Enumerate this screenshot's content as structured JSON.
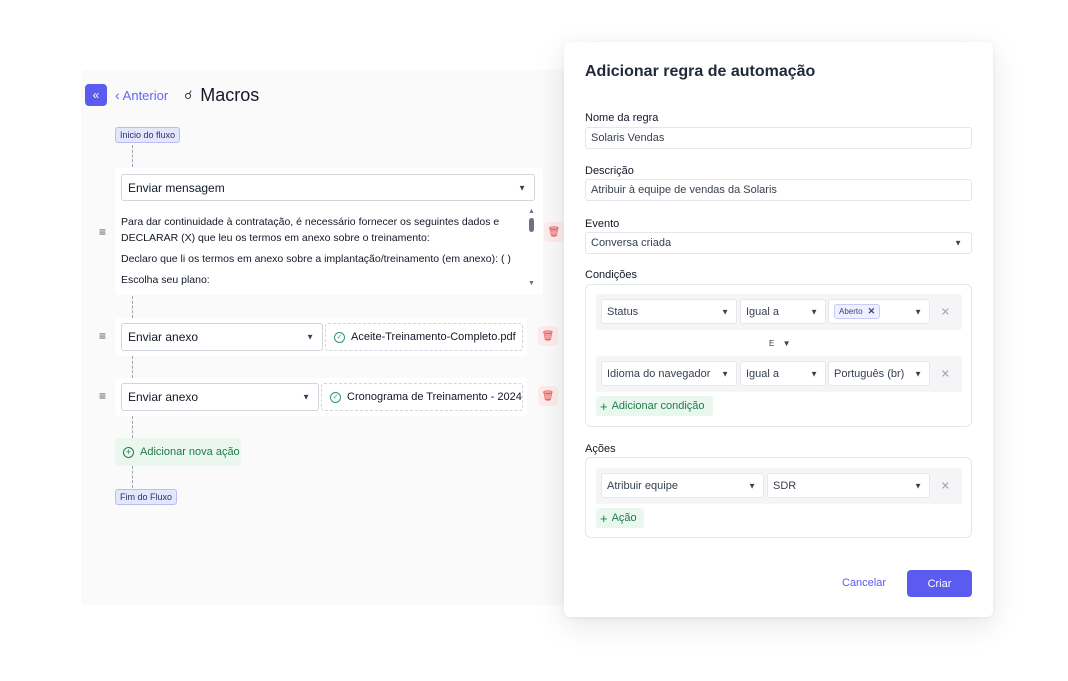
{
  "macros": {
    "back_label": "Anterior",
    "title": "Macros",
    "flow_start": "Inicio do fluxo",
    "flow_end": "Fim do Fluxo",
    "add_action_label": "Adicionar nova ação",
    "steps": [
      {
        "type": "Enviar mensagem",
        "message_lines": [
          "Para dar continuidade à contratação, é necessário fornecer os seguintes dados e",
          "DECLARAR (X) que leu os termos em anexo sobre o treinamento:",
          "Declaro que li os termos em anexo sobre a implantação/treinamento (em anexo): ( )",
          "Escolha seu plano:"
        ]
      },
      {
        "type": "Enviar anexo",
        "file": "Aceite-Treinamento-Completo.pdf"
      },
      {
        "type": "Enviar anexo",
        "file": "Cronograma de Treinamento - 2024..."
      }
    ]
  },
  "modal": {
    "title": "Adicionar regra de automação",
    "rule_name_label": "Nome da regra",
    "rule_name_value": "Solaris Vendas",
    "description_label": "Descrição",
    "description_value": "Atribuir à equipe de vendas da Solaris",
    "event_label": "Evento",
    "event_value": "Conversa criada",
    "conditions_label": "Condições",
    "conditions": [
      {
        "field": "Status",
        "operator": "Igual a",
        "value_chip": "Aberto"
      },
      {
        "field": "Idioma do navegador",
        "operator": "Igual a",
        "value": "Português (br)"
      }
    ],
    "conjunction": "E",
    "add_condition_label": "Adicionar condição",
    "actions_label": "Ações",
    "actions": [
      {
        "action": "Atribuir equipe",
        "value": "SDR"
      }
    ],
    "add_action_label": "Ação",
    "cancel_label": "Cancelar",
    "create_label": "Criar"
  }
}
